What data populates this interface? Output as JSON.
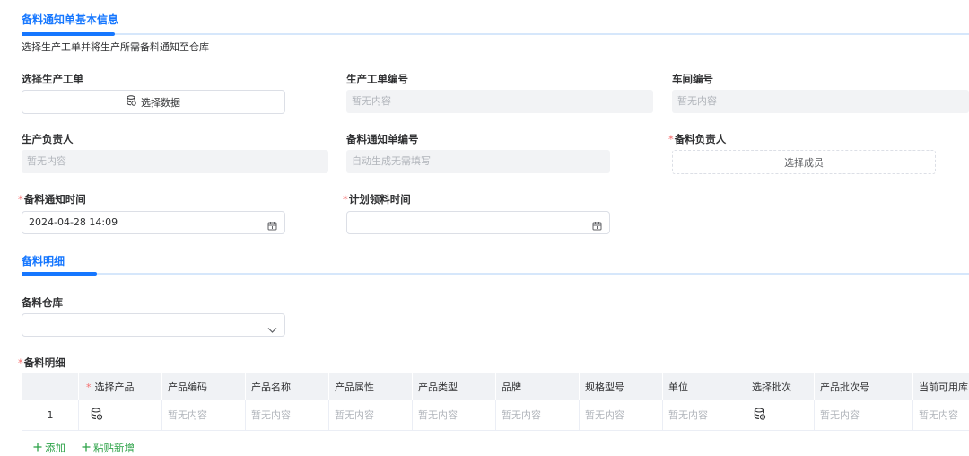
{
  "section1": {
    "title": "备料通知单基本信息",
    "description": "选择生产工单并将生产所需备料通知至仓库"
  },
  "form": {
    "work_order": {
      "label": "选择生产工单",
      "button_label": "选择数据"
    },
    "work_order_no": {
      "label": "生产工单编号",
      "value": "暂无内容"
    },
    "workshop_no": {
      "label": "车间编号",
      "value": "暂无内容"
    },
    "production_manager": {
      "label": "生产负责人",
      "value": "暂无内容"
    },
    "notice_no": {
      "label": "备料通知单编号",
      "value": "自动生成无需填写"
    },
    "material_manager": {
      "label": "备料负责人",
      "required_mark": "*",
      "button_label": "选择成员"
    },
    "notice_time": {
      "label": "备料通知时间",
      "required_mark": "*",
      "value": "2024-04-28 14:09"
    },
    "plan_pick_time": {
      "label": "计划领料时间",
      "required_mark": "*",
      "value": ""
    }
  },
  "section2": {
    "title": "备料明细"
  },
  "warehouse": {
    "label": "备料仓库",
    "value": ""
  },
  "detail": {
    "label": "备料明细",
    "required_mark": "*",
    "columns": [
      "",
      "选择产品",
      "产品编码",
      "产品名称",
      "产品属性",
      "产品类型",
      "品牌",
      "规格型号",
      "单位",
      "选择批次",
      "产品批次号",
      "当前可用库"
    ],
    "product_required_mark": "*",
    "rows": [
      {
        "index": "1",
        "product_code": "暂无内容",
        "product_name": "暂无内容",
        "product_attr": "暂无内容",
        "product_type": "暂无内容",
        "brand": "暂无内容",
        "spec": "暂无内容",
        "unit": "暂无内容",
        "batch_no": "暂无内容",
        "available_stock": "暂无内容"
      }
    ]
  },
  "actions": {
    "add_label": "添加",
    "paste_label": "粘贴新增"
  },
  "icons": {
    "database": "database-icon",
    "calendar": "calendar-icon",
    "chevron": "chevron-down-icon",
    "plus": "plus-icon"
  },
  "colors": {
    "accent": "#1677ff",
    "link": "#2fa34a",
    "required": "#f56c6c"
  }
}
